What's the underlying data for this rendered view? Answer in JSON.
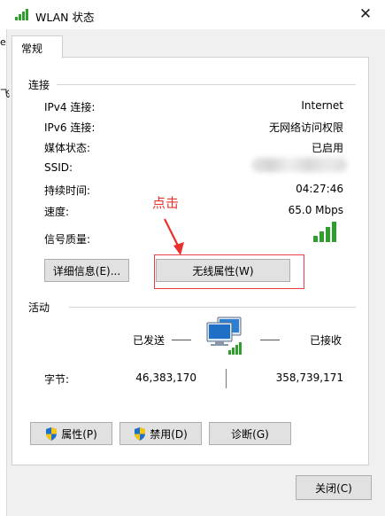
{
  "window": {
    "title": "WLAN 状态"
  },
  "tab": {
    "label": "常规"
  },
  "connection": {
    "section": "连接",
    "rows": [
      {
        "label": "IPv4 连接:",
        "value": "Internet"
      },
      {
        "label": "IPv6 连接:",
        "value": "无网络访问权限"
      },
      {
        "label": "媒体状态:",
        "value": "已启用"
      },
      {
        "label": "SSID:",
        "value": ""
      },
      {
        "label": "持续时间:",
        "value": "04:27:46"
      },
      {
        "label": "速度:",
        "value": "65.0 Mbps"
      },
      {
        "label": "信号质量:",
        "value": ""
      }
    ],
    "details_button": "详细信息(E)...",
    "wireless_button": "无线属性(W)"
  },
  "annotation": {
    "text": "点击",
    "color": "#e8322e"
  },
  "activity": {
    "section": "活动",
    "sent_label": "已发送",
    "received_label": "已接收",
    "bytes_label": "字节:",
    "bytes_sent": "46,383,170",
    "bytes_received": "358,739,171"
  },
  "actions": {
    "properties": "属性(P)",
    "disable": "禁用(D)",
    "diagnose": "诊断(G)"
  },
  "footer": {
    "close": "关闭(C)"
  },
  "bleed": {
    "top_char": "e",
    "bottom_char": "飞"
  },
  "colors": {
    "signal": "#2e9e2e",
    "highlight": "#e84040",
    "accent": "#0078d7"
  }
}
